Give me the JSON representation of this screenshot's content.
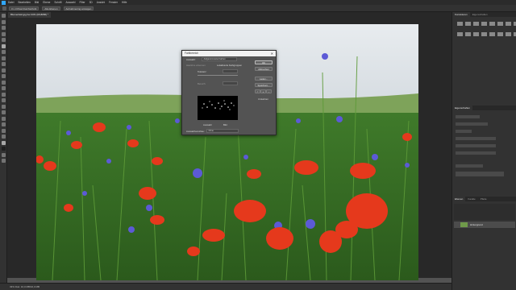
{
  "menubar": {
    "items": [
      "Datei",
      "Bearbeiten",
      "Bild",
      "Ebene",
      "Schrift",
      "Auswahl",
      "Filter",
      "3D",
      "Ansicht",
      "Fenster",
      "Hilfe"
    ]
  },
  "options": {
    "sample_size": "3 x 3 Pixel Durchschnitt",
    "sample_layers": "Alle Ebenen",
    "sample_ring": "Aufnahmering anzeigen"
  },
  "document": {
    "tab_title": "Blumenfeld.jpg bei 33% (RGB/8#) *"
  },
  "status": {
    "text": "33%   Dok: 16,0 MB/16,0 MB"
  },
  "panels": {
    "top_tabs": [
      "Korrekturen",
      "Eigenschaften"
    ],
    "properties_tabs": [
      "Eigenschaften"
    ],
    "layers_tabs": [
      "Ebenen",
      "Kanäle",
      "Pfade"
    ],
    "layer_name": "Hintergrund"
  },
  "dialog": {
    "title": "Farbbereich",
    "auswahl_label": "Auswahl:",
    "auswahl_value": "Aufgenommene Farben",
    "hauttone_label": "Hauttöne erkennen",
    "lokalisiert_label": "Lokalisierte Farbgruppen",
    "toleranz_label": "Toleranz:",
    "bereich_label": "Bereich:",
    "auswahl_radio": "Auswahl",
    "bild_radio": "Bild",
    "auswahlvorschau_label": "Auswahlvorschau:",
    "auswahlvorschau_value": "Ohne",
    "ok": "OK",
    "abbrechen": "Abbrechen",
    "laden": "Laden...",
    "speichern": "Speichern...",
    "umkehren": "Umkehren"
  }
}
